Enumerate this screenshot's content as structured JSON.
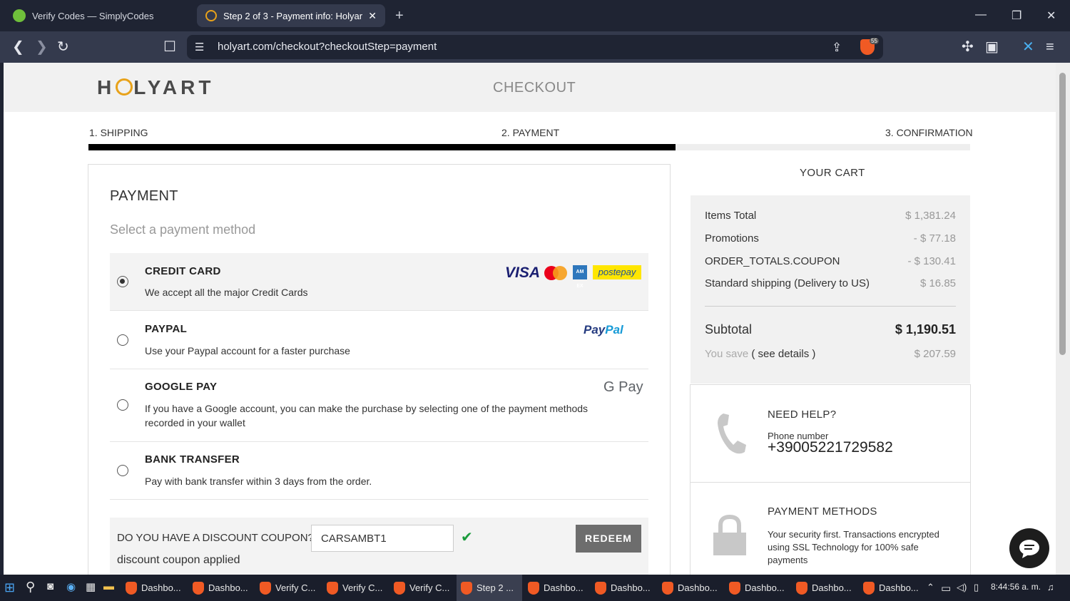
{
  "browser": {
    "tabs": [
      {
        "title": "Verify Codes — SimplyCodes",
        "active": false
      },
      {
        "title": "Step 2 of 3 - Payment info: Holyart",
        "active": true
      }
    ],
    "url": "holyart.com/checkout?checkoutStep=payment",
    "shields_badge": "55"
  },
  "header": {
    "logo": "HOLYART",
    "title": "CHECKOUT"
  },
  "steps": [
    {
      "label": "1. SHIPPING"
    },
    {
      "label": "2. PAYMENT"
    },
    {
      "label": "3. CONFIRMATION"
    }
  ],
  "progress": {
    "completed_steps": 2,
    "total_steps": 3
  },
  "payment": {
    "title": "PAYMENT",
    "subtitle": "Select a payment method",
    "methods": [
      {
        "title": "CREDIT CARD",
        "desc": "We accept all the major Credit Cards",
        "selected": true,
        "logos": [
          "VISA",
          "mastercard",
          "amex",
          "postepay"
        ]
      },
      {
        "title": "PAYPAL",
        "desc": "Use your Paypal account for a faster purchase",
        "selected": false,
        "logo": "PayPal"
      },
      {
        "title": "GOOGLE PAY",
        "desc": "If you have a Google account, you can make the purchase by selecting one of the payment methods recorded in your wallet",
        "selected": false,
        "logo": "G Pay"
      },
      {
        "title": "BANK TRANSFER",
        "desc": "Pay with bank transfer within 3 days from the order.",
        "selected": false
      }
    ],
    "logo_text": {
      "visa": "VISA",
      "postepay": "postepay",
      "amex": "AM EX",
      "paypal_a": "Pay",
      "paypal_b": "Pal",
      "gpay": "G Pay"
    }
  },
  "coupon": {
    "question": "DO YOU HAVE A DISCOUNT COUPON?",
    "value": "CARSAMBT1",
    "redeem_label": "REDEEM",
    "status": "discount coupon applied",
    "check": "✔"
  },
  "cart": {
    "title": "YOUR CART",
    "rows": [
      {
        "label": "Items Total",
        "value": "$ 1,381.24"
      },
      {
        "label": "Promotions",
        "value": "- $ 77.18"
      },
      {
        "label": "ORDER_TOTALS.COUPON",
        "value": "- $ 130.41"
      },
      {
        "label": "Standard shipping (Delivery to US)",
        "value": "$ 16.85"
      }
    ],
    "subtotal_label": "Subtotal",
    "subtotal_value": "$ 1,190.51",
    "save_label": "You save",
    "save_link": "( see details )",
    "save_value": "$ 207.59"
  },
  "help": {
    "title": "NEED HELP?",
    "phone_label": "Phone number",
    "phone": "+39005221729582"
  },
  "methods_info": {
    "title": "PAYMENT METHODS",
    "text": "Your security first. Transactions encrypted using SSL Technology for 100% safe payments"
  },
  "taskbar": {
    "items": [
      {
        "label": "Dashbo..."
      },
      {
        "label": "Dashbo..."
      },
      {
        "label": "Verify C..."
      },
      {
        "label": "Verify C..."
      },
      {
        "label": "Verify C..."
      },
      {
        "label": "Step 2 ...",
        "active": true
      },
      {
        "label": "Dashbo..."
      },
      {
        "label": "Dashbo..."
      },
      {
        "label": "Dashbo..."
      },
      {
        "label": "Dashbo..."
      },
      {
        "label": "Dashbo..."
      },
      {
        "label": "Dashbo..."
      }
    ],
    "time": "8:44:56 a. m."
  },
  "colors": {
    "accent_check": "#1a9b3c",
    "logo_ring": "#e8a21a",
    "brave": "#f05a24"
  }
}
